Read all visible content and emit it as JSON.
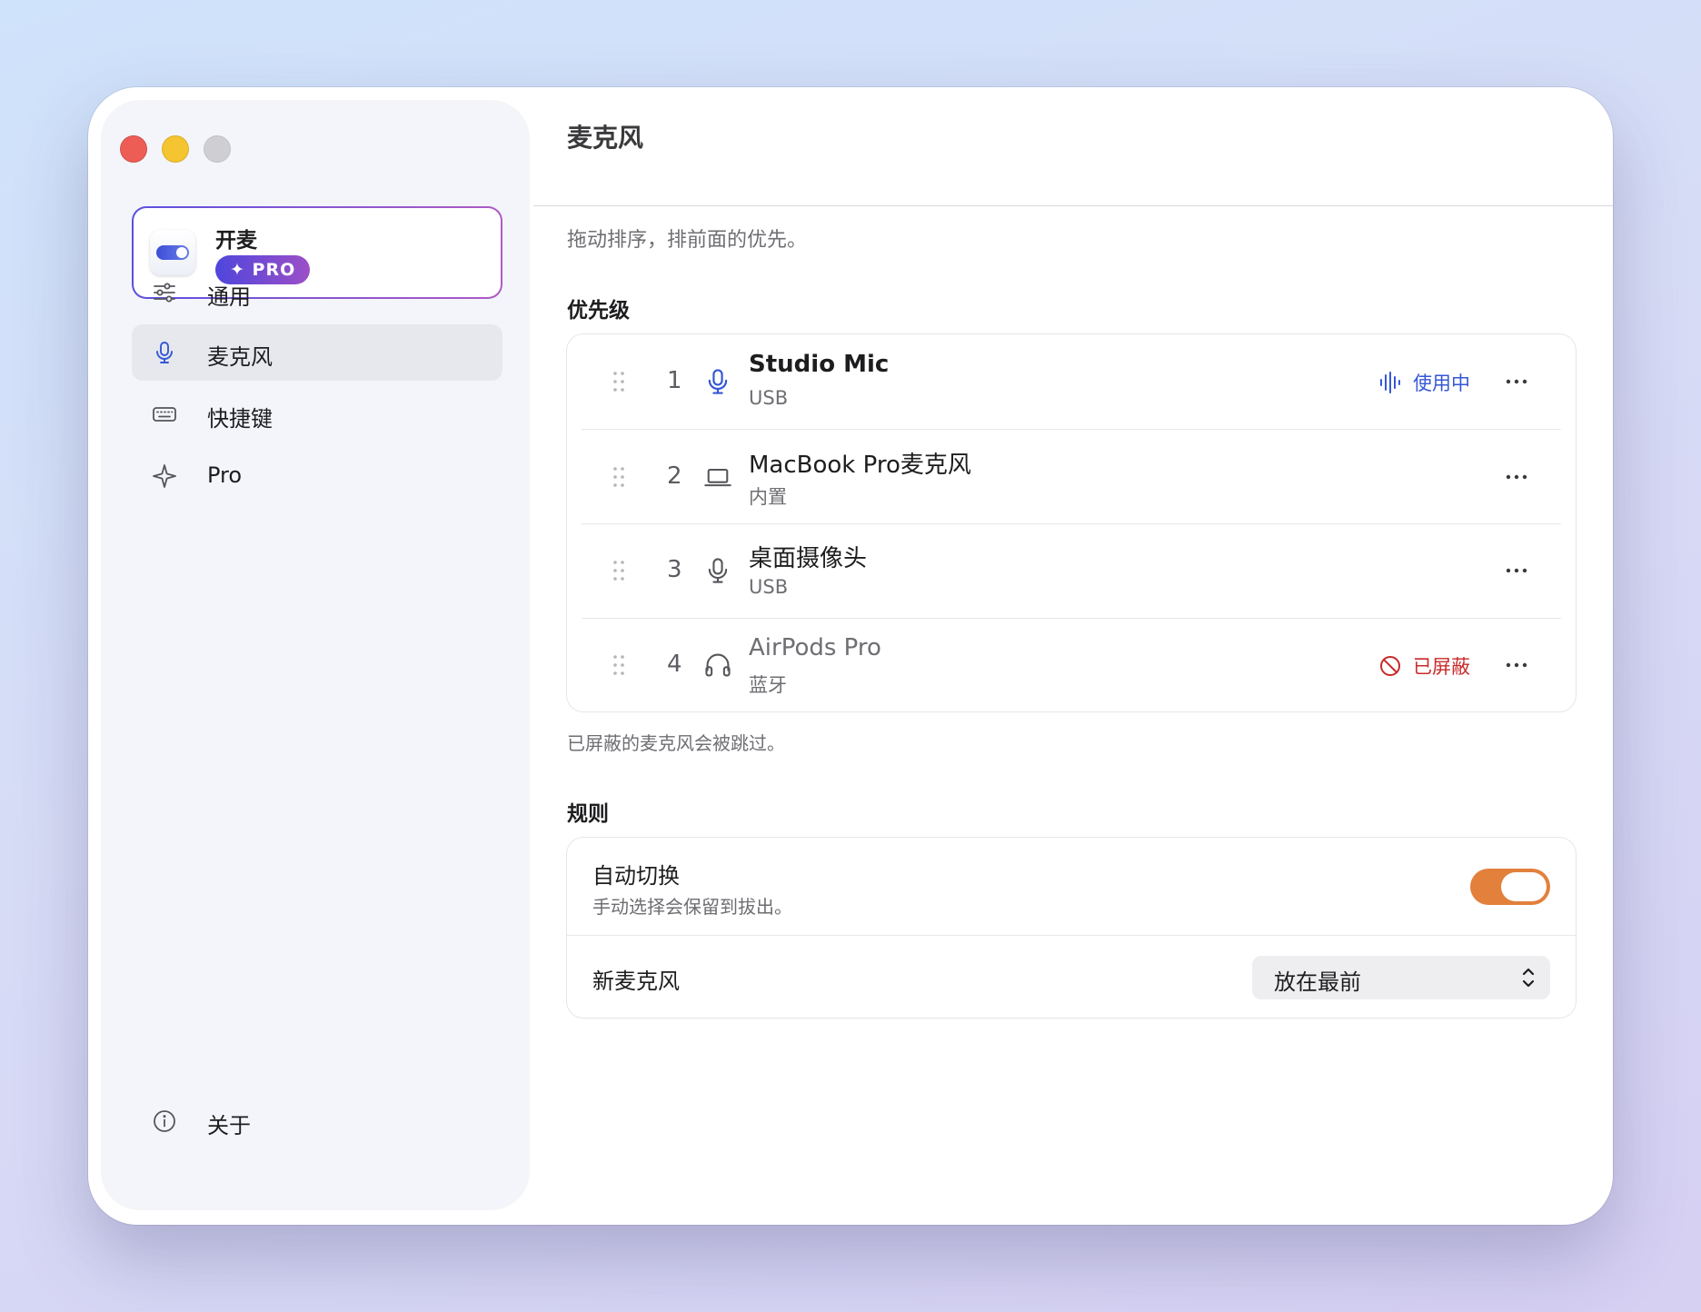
{
  "app": {
    "name": "开麦",
    "badge": "✦ PRO"
  },
  "sidebar": {
    "items": [
      {
        "label": "通用",
        "icon": "sliders-icon"
      },
      {
        "label": "麦克风",
        "icon": "microphone-icon",
        "active": true
      },
      {
        "label": "快捷键",
        "icon": "keyboard-icon"
      },
      {
        "label": "Pro",
        "icon": "sparkle-icon"
      }
    ],
    "footer": {
      "label": "关于",
      "icon": "info-icon"
    }
  },
  "main": {
    "title": "麦克风",
    "subtitle": "拖动排序，排前面的优先。",
    "priority_heading": "优先级",
    "devices": [
      {
        "rank": "1",
        "name": "Studio Mic",
        "type": "USB",
        "icon": "microphone-icon",
        "status": "使用中",
        "status_kind": "active"
      },
      {
        "rank": "2",
        "name": "MacBook Pro麦克风",
        "type": "内置",
        "icon": "laptop-icon",
        "status": "",
        "status_kind": "none"
      },
      {
        "rank": "3",
        "name": "桌面摄像头",
        "type": "USB",
        "icon": "microphone-icon",
        "status": "",
        "status_kind": "none"
      },
      {
        "rank": "4",
        "name": "AirPods Pro",
        "type": "蓝牙",
        "icon": "headphones-icon",
        "status": "已屏蔽",
        "status_kind": "blocked"
      }
    ],
    "blocked_note": "已屏蔽的麦克风会被跳过。",
    "rules_heading": "规则",
    "rules": {
      "auto_switch_label": "自动切换",
      "auto_switch_desc": "手动选择会保留到拔出。",
      "auto_switch_on": true,
      "new_mic_label": "新麦克风",
      "new_mic_value": "放在最前"
    }
  },
  "colors": {
    "accent_blue": "#3557d6",
    "blocked_red": "#c92a2a",
    "toggle_orange": "#e2803c",
    "pro_gradient_start": "#4f46dc",
    "pro_gradient_end": "#9c4fc7"
  }
}
